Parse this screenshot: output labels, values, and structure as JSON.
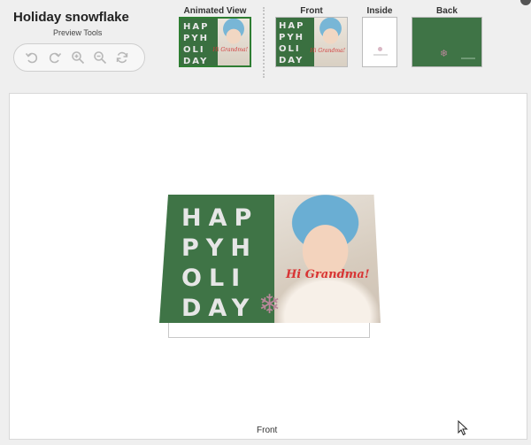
{
  "app": {
    "title": "Holiday snowflake",
    "tools_label": "Preview Tools"
  },
  "tools": [
    {
      "name": "undo-icon",
      "label": "Undo"
    },
    {
      "name": "redo-icon",
      "label": "Redo"
    },
    {
      "name": "zoom-in-icon",
      "label": "Zoom in"
    },
    {
      "name": "zoom-out-icon",
      "label": "Zoom out"
    },
    {
      "name": "refresh-icon",
      "label": "Refresh"
    }
  ],
  "views": {
    "animated": "Animated View",
    "front": "Front",
    "inside": "Inside",
    "back": "Back"
  },
  "card": {
    "greeting_lines": [
      "HAP",
      "PYH",
      "OLI",
      "DAY"
    ],
    "message": "Hi Grandma!",
    "caption": "Front"
  },
  "colors": {
    "card_green": "#3f7446",
    "selected_border": "#2e7d32",
    "message_red": "#d83434"
  }
}
